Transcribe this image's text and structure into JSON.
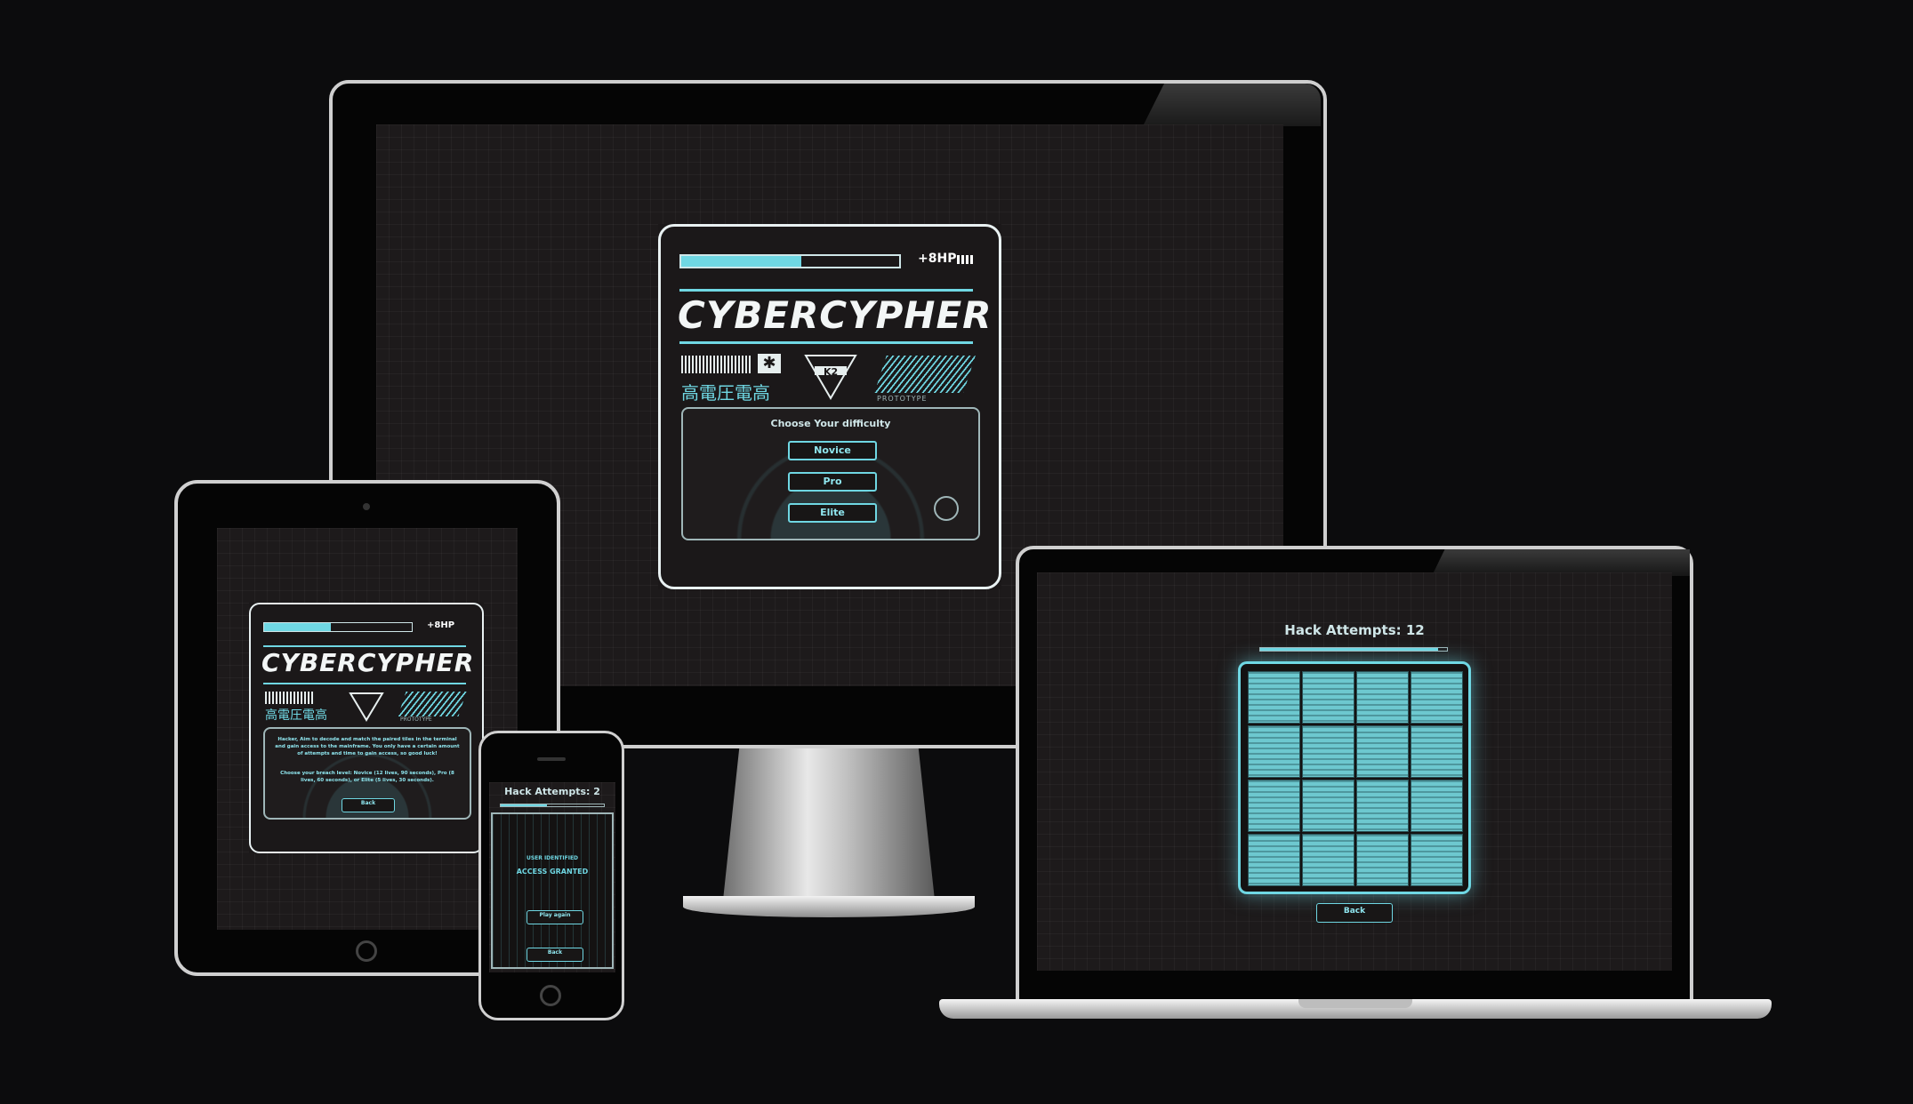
{
  "app": {
    "title": "CYBERCYPHER",
    "hp_label": "+8HP",
    "kanji": "高電圧電高",
    "badge": "K2",
    "prototype_label": "PROTOTYPE"
  },
  "desktop": {
    "menu_heading": "Choose Your difficulty",
    "difficulties": [
      "Novice",
      "Pro",
      "Elite"
    ],
    "hp_fill": 0.55
  },
  "tablet": {
    "instructions_1": "Hacker, Aim to decode and match the paired tiles in the terminal and gain access to the mainframe. You only have a certain amount of attempts and time to gain access, so good luck!",
    "instructions_2": "Choose your breach level: Novice (12 lives, 90 seconds), Pro (8 lives, 60 seconds), or Elite (5 lives, 30 seconds).",
    "back_label": "Back",
    "hp_fill": 0.45
  },
  "phone": {
    "attempts_label": "Hack Attempts: 2",
    "user_identified": "USER IDENTIFIED",
    "access_granted": "ACCESS GRANTED",
    "play_again": "Play again",
    "back_label": "Back",
    "progress": 0.45
  },
  "laptop": {
    "attempts_label": "Hack Attempts: 12",
    "back_label": "Back",
    "grid_rows": 4,
    "grid_cols": 4,
    "progress": 0.95
  },
  "colors": {
    "accent": "#6fd7e3",
    "background": "#0c0c0d",
    "screen": "#1d1a1b"
  }
}
